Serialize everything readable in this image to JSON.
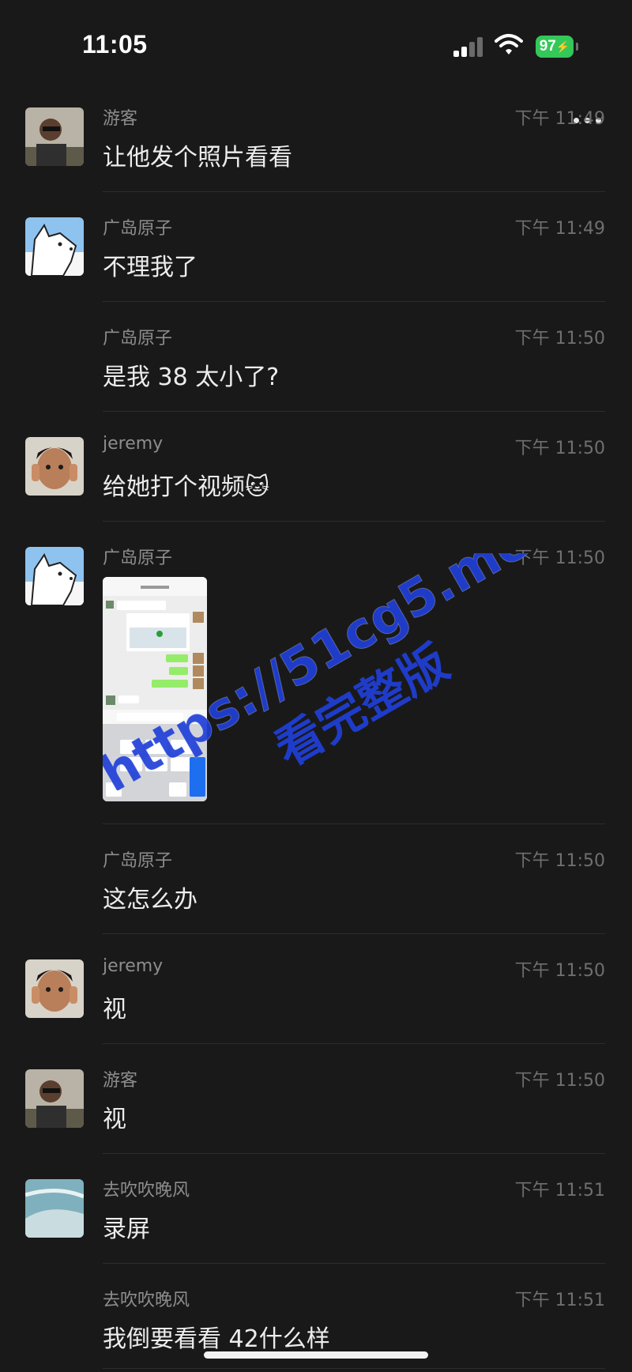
{
  "status_bar": {
    "time": "11:05",
    "battery": "97"
  },
  "messages": [
    {
      "name": "游客",
      "time": "下午 11:49",
      "text": "让他发个照片看看"
    },
    {
      "name": "广岛原子",
      "time": "下午 11:49",
      "text": "不理我了"
    },
    {
      "name": "广岛原子",
      "time": "下午 11:50",
      "text": "是我 38 太小了?"
    },
    {
      "name": "jeremy",
      "time": "下午 11:50",
      "text": "给她打个视频",
      "emoji": "🐱"
    },
    {
      "name": "广岛原子",
      "time": "下午 11:50"
    },
    {
      "name": "广岛原子",
      "time": "下午 11:50",
      "text": "这怎么办"
    },
    {
      "name": "jeremy",
      "time": "下午 11:50",
      "text": "视"
    },
    {
      "name": "游客",
      "time": "下午 11:50",
      "text": "视"
    },
    {
      "name": "去吹吹晚风",
      "time": "下午 11:51",
      "text": "录屏"
    },
    {
      "name": "去吹吹晚风",
      "time": "下午 11:51",
      "text": "我倒要看看 42什么样"
    }
  ],
  "watermark": {
    "line1": "https://51cg5.me",
    "line2": "看完整版",
    "color": "#1f3fd8"
  },
  "colors": {
    "background": "#191919",
    "text": "#ececec",
    "meta": "#8d8d8d",
    "divider": "#2d2d2d"
  }
}
